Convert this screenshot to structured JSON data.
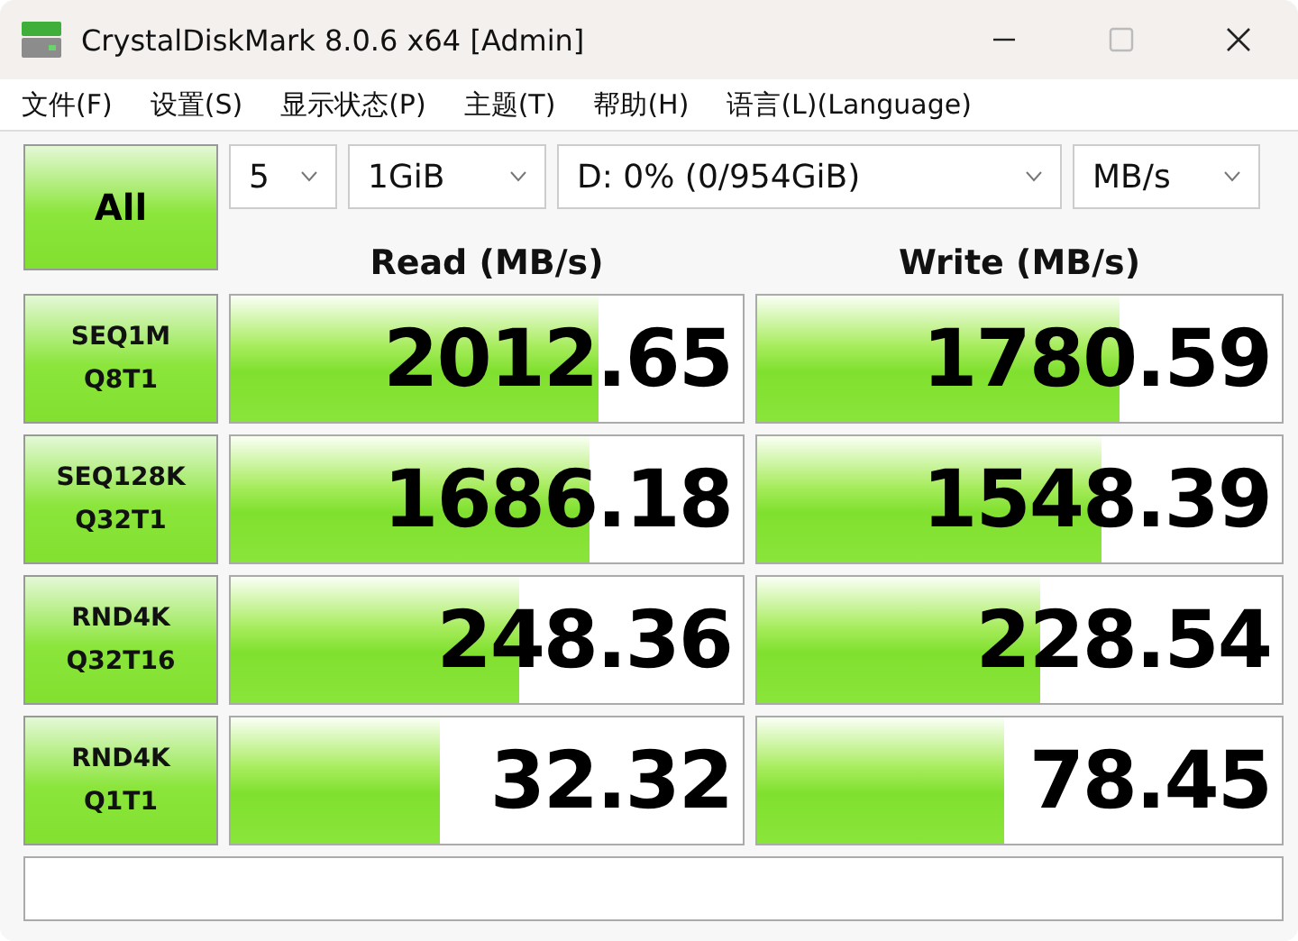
{
  "window": {
    "title": "CrystalDiskMark 8.0.6 x64 [Admin]"
  },
  "menu": [
    "文件(F)",
    "设置(S)",
    "显示状态(P)",
    "主题(T)",
    "帮助(H)",
    "语言(L)(Language)"
  ],
  "all_button": "All",
  "selectors": [
    {
      "value": "5"
    },
    {
      "value": "1GiB"
    },
    {
      "value": "D: 0% (0/954GiB)"
    },
    {
      "value": "MB/s"
    }
  ],
  "headers": [
    "Read (MB/s)",
    "Write (MB/s)"
  ],
  "tests": [
    {
      "name": "SEQ1M",
      "params": "Q8T1",
      "read": {
        "reading": "2012.65",
        "level": 0.72
      },
      "write": {
        "reading": "1780.59",
        "level": 0.69
      }
    },
    {
      "name": "SEQ128K",
      "params": "Q32T1",
      "read": {
        "reading": "1686.18",
        "level": 0.7
      },
      "write": {
        "reading": "1548.39",
        "level": 0.655
      }
    },
    {
      "name": "RND4K",
      "params": "Q32T16",
      "read": {
        "reading": "248.36",
        "level": 0.565
      },
      "write": {
        "reading": "228.54",
        "level": 0.54
      }
    },
    {
      "name": "RND4K",
      "params": "Q1T1",
      "read": {
        "reading": "32.32",
        "level": 0.41
      },
      "write": {
        "reading": "78.45",
        "level": 0.47
      }
    }
  ]
}
